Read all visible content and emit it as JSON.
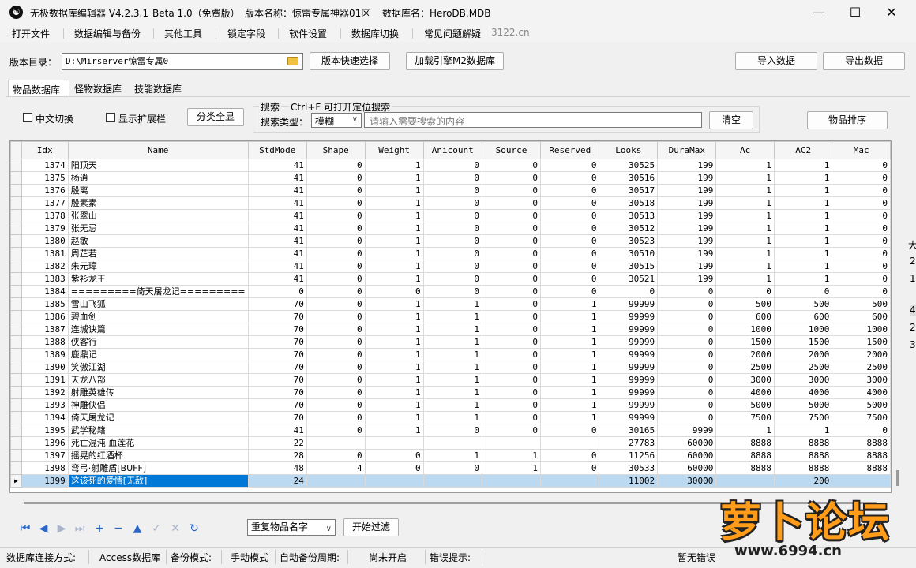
{
  "titlebar": {
    "app_name": "无极数据库编辑器 V4.2.3.1",
    "edition": "Beta 1.0（免费版）",
    "version_name": "版本名称：惊雷专属神器01区",
    "db_name": "数据库名：HeroDB.MDB",
    "app_icon": "yin-yang-icon"
  },
  "menu": [
    "打开文件",
    "数据编辑与备份",
    "其他工具",
    "锁定字段",
    "软件设置",
    "数据库切换",
    "常见问题解疑"
  ],
  "menu_link": "3122.cn",
  "toolbar": {
    "dir_label": "版本目录：",
    "dir_value": "D:\\Mirserver惊雷专属0",
    "quick_select": "版本快速选择",
    "load_engine": "加载引擎M2数据库",
    "import": "导入数据",
    "export": "导出数据"
  },
  "tabs": [
    "物品数据库",
    "怪物数据库",
    "技能数据库"
  ],
  "filters": {
    "chinese_switch": "中文切换",
    "show_extend": "显示扩展栏",
    "category_all": "分类全显",
    "search_title": "搜索",
    "search_hint": "Ctrl+F 可打开定位搜索",
    "search_type_label": "搜索类型：",
    "search_type_value": "模糊",
    "search_placeholder": "请输入需要搜索的内容",
    "clear": "清空",
    "sort": "物品排序"
  },
  "grid": {
    "columns": [
      "Idx",
      "Name",
      "StdMode",
      "Shape",
      "Weight",
      "Anicount",
      "Source",
      "Reserved",
      "Looks",
      "DuraMax",
      "Ac",
      "AC2",
      "Mac"
    ],
    "rows": [
      [
        "1374",
        "阳顶天",
        "41",
        "0",
        "1",
        "0",
        "0",
        "0",
        "30525",
        "199",
        "1",
        "1",
        "0"
      ],
      [
        "1375",
        "杨逍",
        "41",
        "0",
        "1",
        "0",
        "0",
        "0",
        "30516",
        "199",
        "1",
        "1",
        "0"
      ],
      [
        "1376",
        "殷离",
        "41",
        "0",
        "1",
        "0",
        "0",
        "0",
        "30517",
        "199",
        "1",
        "1",
        "0"
      ],
      [
        "1377",
        "殷素素",
        "41",
        "0",
        "1",
        "0",
        "0",
        "0",
        "30518",
        "199",
        "1",
        "1",
        "0"
      ],
      [
        "1378",
        "张翠山",
        "41",
        "0",
        "1",
        "0",
        "0",
        "0",
        "30513",
        "199",
        "1",
        "1",
        "0"
      ],
      [
        "1379",
        "张无忌",
        "41",
        "0",
        "1",
        "0",
        "0",
        "0",
        "30512",
        "199",
        "1",
        "1",
        "0"
      ],
      [
        "1380",
        "赵敏",
        "41",
        "0",
        "1",
        "0",
        "0",
        "0",
        "30523",
        "199",
        "1",
        "1",
        "0"
      ],
      [
        "1381",
        "周芷若",
        "41",
        "0",
        "1",
        "0",
        "0",
        "0",
        "30510",
        "199",
        "1",
        "1",
        "0"
      ],
      [
        "1382",
        "朱元璋",
        "41",
        "0",
        "1",
        "0",
        "0",
        "0",
        "30515",
        "199",
        "1",
        "1",
        "0"
      ],
      [
        "1383",
        "紫衫龙王",
        "41",
        "0",
        "1",
        "0",
        "0",
        "0",
        "30521",
        "199",
        "1",
        "1",
        "0"
      ],
      [
        "1384",
        "=========倚天屠龙记=========",
        "0",
        "0",
        "0",
        "0",
        "0",
        "0",
        "0",
        "0",
        "0",
        "0",
        "0"
      ],
      [
        "1385",
        "雪山飞狐",
        "70",
        "0",
        "1",
        "1",
        "0",
        "1",
        "99999",
        "0",
        "500",
        "500",
        "500"
      ],
      [
        "1386",
        "碧血剑",
        "70",
        "0",
        "1",
        "1",
        "0",
        "1",
        "99999",
        "0",
        "600",
        "600",
        "600"
      ],
      [
        "1387",
        "连城诀篇",
        "70",
        "0",
        "1",
        "1",
        "0",
        "1",
        "99999",
        "0",
        "1000",
        "1000",
        "1000"
      ],
      [
        "1388",
        "侠客行",
        "70",
        "0",
        "1",
        "1",
        "0",
        "1",
        "99999",
        "0",
        "1500",
        "1500",
        "1500"
      ],
      [
        "1389",
        "鹿鼎记",
        "70",
        "0",
        "1",
        "1",
        "0",
        "1",
        "99999",
        "0",
        "2000",
        "2000",
        "2000"
      ],
      [
        "1390",
        "笑傲江湖",
        "70",
        "0",
        "1",
        "1",
        "0",
        "1",
        "99999",
        "0",
        "2500",
        "2500",
        "2500"
      ],
      [
        "1391",
        "天龙八部",
        "70",
        "0",
        "1",
        "1",
        "0",
        "1",
        "99999",
        "0",
        "3000",
        "3000",
        "3000"
      ],
      [
        "1392",
        "射雕英雄传",
        "70",
        "0",
        "1",
        "1",
        "0",
        "1",
        "99999",
        "0",
        "4000",
        "4000",
        "4000"
      ],
      [
        "1393",
        "神雕侠侣",
        "70",
        "0",
        "1",
        "1",
        "0",
        "1",
        "99999",
        "0",
        "5000",
        "5000",
        "5000"
      ],
      [
        "1394",
        "倚天屠龙记",
        "70",
        "0",
        "1",
        "1",
        "0",
        "1",
        "99999",
        "0",
        "7500",
        "7500",
        "7500"
      ],
      [
        "1395",
        "武学秘籍",
        "41",
        "0",
        "1",
        "0",
        "0",
        "0",
        "30165",
        "9999",
        "1",
        "1",
        "0"
      ],
      [
        "1396",
        "死亡混沌·血莲花",
        "22",
        "",
        "",
        "",
        "",
        "",
        "27783",
        "60000",
        "8888",
        "8888",
        "8888"
      ],
      [
        "1397",
        "摇晃的红酒杯",
        "28",
        "0",
        "0",
        "1",
        "1",
        "0",
        "11256",
        "60000",
        "8888",
        "8888",
        "8888"
      ],
      [
        "1398",
        "弯弓·射雕盾[BUFF]",
        "48",
        "4",
        "0",
        "0",
        "1",
        "0",
        "30533",
        "60000",
        "8888",
        "8888",
        "8888"
      ],
      [
        "1399",
        "这该死的爱情[无敌]",
        "24",
        "",
        "",
        "",
        "",
        "",
        "11002",
        "30000",
        "",
        "200",
        ""
      ]
    ],
    "selected_row_index": 25
  },
  "nav_icons": [
    "first-icon",
    "prev-icon",
    "next-icon",
    "last-icon",
    "add-icon",
    "delete-icon",
    "up-icon",
    "confirm-icon",
    "cancel-icon",
    "refresh-icon"
  ],
  "bottom": {
    "filter_select": "重复物品名字",
    "filter_button": "开始过滤"
  },
  "status": {
    "conn_label": "数据库连接方式:",
    "conn_value": "Access数据库",
    "backup_mode_label": "备份模式:",
    "backup_mode_value": "手动模式",
    "auto_backup_label": "自动备份周期:",
    "auto_backup_value": "尚未开启",
    "error_label": "错误提示:",
    "error_value": "暂无错误"
  },
  "right_edge": [
    "大",
    "2",
    "1",
    "4",
    "2",
    "3"
  ],
  "watermark": {
    "main": "萝卜论坛",
    "url": "www.6994.cn"
  },
  "colors": {
    "selection": "#0078d7",
    "selection_light": "#bcd9f2",
    "watermark": "#ff9c1a"
  }
}
